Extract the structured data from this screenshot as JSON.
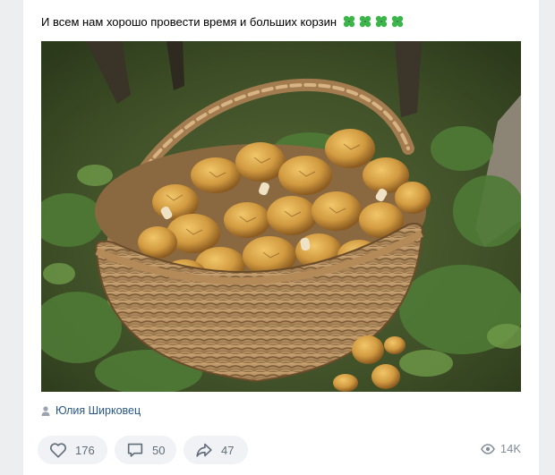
{
  "post": {
    "text": "И всем нам хорошо провести время и больших корзин",
    "emoji_count": 4,
    "photo_icon": "basket-of-morel-mushrooms-photo"
  },
  "author": {
    "name": "Юлия Ширковец",
    "icon": "person-icon"
  },
  "actions": {
    "likes": "176",
    "comments": "50",
    "shares": "47",
    "views": "14K"
  },
  "colors": {
    "link": "#2a5885",
    "pill_bg": "#f0f2f5",
    "muted": "#626d7a",
    "clover": "#3bb54a"
  }
}
